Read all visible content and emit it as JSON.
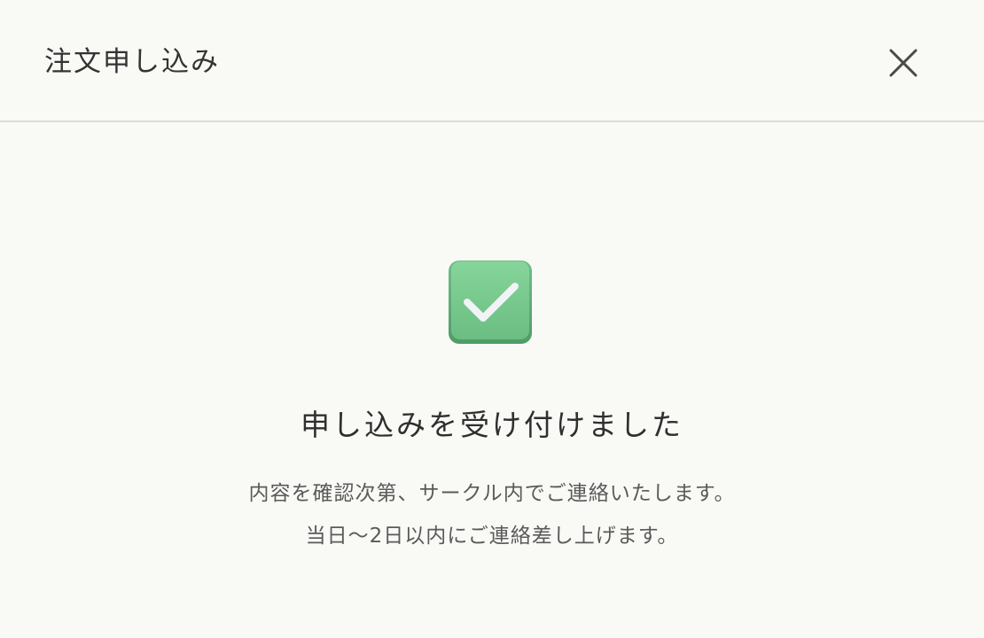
{
  "dialog": {
    "title": "注文申し込み",
    "close_icon": "close-icon"
  },
  "result": {
    "icon": "check-mark-icon",
    "icon_color": "#7dcf93",
    "heading": "申し込みを受け付けました",
    "message_line1": "内容を確認次第、サークル内でご連絡いたします。",
    "message_line2": "当日〜2日以内にご連絡差し上げます。"
  }
}
